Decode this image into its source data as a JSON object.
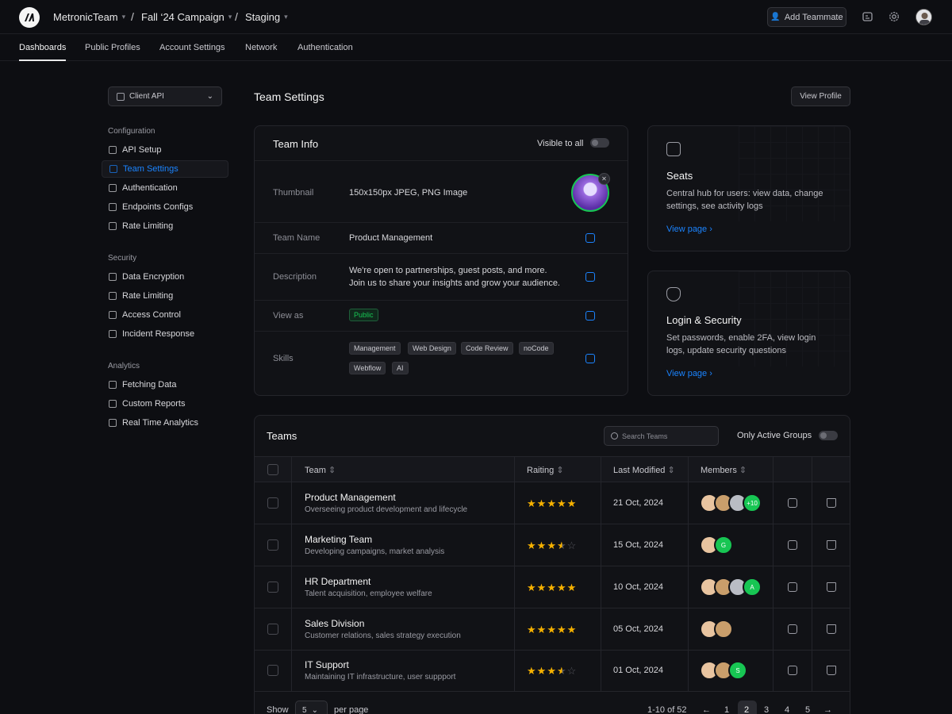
{
  "topbar": {
    "team": "MetronicTeam",
    "campaign": "Fall ‘24 Campaign",
    "env": "Staging",
    "add_teammate": "Add Teammate"
  },
  "tabs": [
    "Dashboards",
    "Public Profiles",
    "Account Settings",
    "Network",
    "Authentication"
  ],
  "sidebar": {
    "select_value": "Client API",
    "groups": [
      {
        "title": "Configuration",
        "items": [
          "API Setup",
          "Team Settings",
          "Authentication",
          "Endpoints Configs",
          "Rate Limiting"
        ]
      },
      {
        "title": "Security",
        "items": [
          "Data Encryption",
          "Rate Limiting",
          "Access Control",
          "Incident Response"
        ]
      },
      {
        "title": "Analytics",
        "items": [
          "Fetching Data",
          "Custom Reports",
          "Real Time Analytics"
        ]
      }
    ]
  },
  "page": {
    "title": "Team Settings",
    "view_profile": "View Profile"
  },
  "team_info": {
    "title": "Team Info",
    "visible_label": "Visible to all",
    "thumbnail_label": "Thumbnail",
    "thumbnail_hint": "150x150px JPEG, PNG Image",
    "team_name_label": "Team Name",
    "team_name": "Product Management",
    "description_label": "Description",
    "description_1": "We're open to partnerships, guest posts, and more.",
    "description_2": "Join us to share your insights and grow your audience.",
    "view_as_label": "View as",
    "view_as": "Public",
    "skills_label": "Skills",
    "skills": [
      "Management",
      "Web Design",
      "Code Review",
      "noCode",
      "Webflow",
      "AI"
    ]
  },
  "seats": {
    "title": "Seats",
    "desc": "Central hub for users: view data, change settings, see activity logs",
    "link": "View page"
  },
  "login_security": {
    "title": "Login & Security",
    "desc": "Set passwords, enable 2FA, view login logs, update security questions",
    "link": "View page"
  },
  "teams": {
    "title": "Teams",
    "search_placeholder": "Search Teams",
    "only_active": "Only Active Groups",
    "columns": [
      "Team",
      "Raiting",
      "Last Modified",
      "Members"
    ],
    "rows": [
      {
        "name": "Product Management",
        "desc": "Overseeing product development and lifecycle",
        "rating": 5,
        "date": "21 Oct, 2024",
        "extra": "+10"
      },
      {
        "name": "Marketing Team",
        "desc": "Developing campaigns, market analysis",
        "rating": 3.5,
        "date": "15 Oct, 2024",
        "extra": "G"
      },
      {
        "name": "HR Department",
        "desc": "Talent acquisition, employee welfare",
        "rating": 5,
        "date": "10 Oct, 2024",
        "extra": "A"
      },
      {
        "name": "Sales Division",
        "desc": "Customer relations, sales strategy execution",
        "rating": 5,
        "date": "05 Oct, 2024",
        "extra": ""
      },
      {
        "name": "IT Support",
        "desc": "Maintaining IT infrastructure, user suppport",
        "rating": 3.5,
        "date": "01 Oct, 2024",
        "extra": "S"
      }
    ]
  },
  "pagination": {
    "show": "Show",
    "per_page_value": "5",
    "per_page": "per page",
    "range": "1-10 of 52",
    "pages": [
      "1",
      "2",
      "3",
      "4",
      "5"
    ],
    "current": "2"
  },
  "colors": {
    "accent": "#1b84ff",
    "success": "#17c653",
    "star": "#f6b100"
  }
}
